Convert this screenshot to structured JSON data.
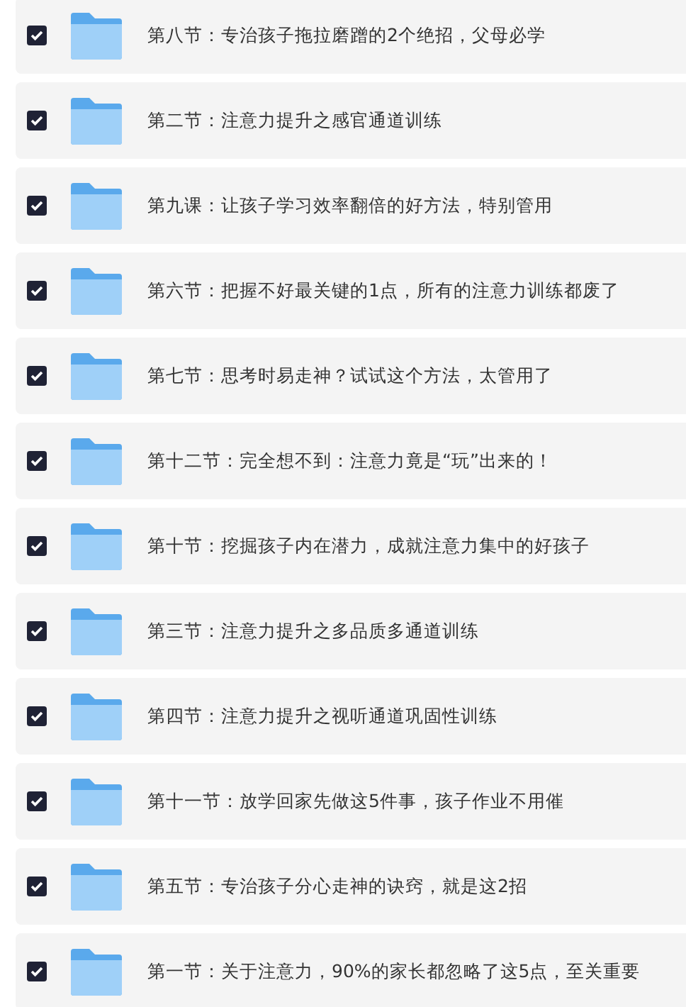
{
  "items": [
    {
      "title": "第八节：专治孩子拖拉磨蹭的2个绝招，父母必学",
      "checked": true
    },
    {
      "title": "第二节：注意力提升之感官通道训练",
      "checked": true
    },
    {
      "title": "第九课：让孩子学习效率翻倍的好方法，特别管用",
      "checked": true
    },
    {
      "title": "第六节：把握不好最关键的1点，所有的注意力训练都废了",
      "checked": true
    },
    {
      "title": "第七节：思考时易走神？试试这个方法，太管用了",
      "checked": true
    },
    {
      "title": "第十二节：完全想不到：注意力竟是“玩”出来的！",
      "checked": true
    },
    {
      "title": "第十节：挖掘孩子内在潜力，成就注意力集中的好孩子",
      "checked": true
    },
    {
      "title": "第三节：注意力提升之多品质多通道训练",
      "checked": true
    },
    {
      "title": "第四节：注意力提升之视听通道巩固性训练",
      "checked": true
    },
    {
      "title": "第十一节：放学回家先做这5件事，孩子作业不用催",
      "checked": true
    },
    {
      "title": "第五节：专治孩子分心走神的诀窍，就是这2招",
      "checked": true
    },
    {
      "title": "第一节：关于注意力，90%的家长都忽略了这5点，至关重要",
      "checked": true
    }
  ]
}
